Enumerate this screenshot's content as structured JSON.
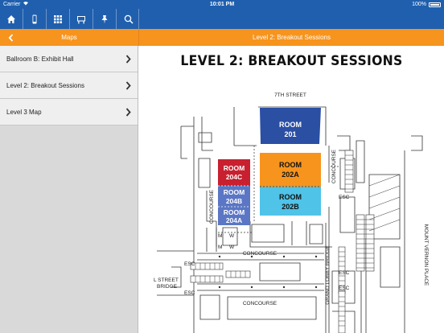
{
  "status": {
    "carrier": "Carrier",
    "time": "10:01 PM",
    "battery": "100%"
  },
  "toolbar": {
    "icons": [
      "home-icon",
      "phone-icon",
      "grid-icon",
      "exhibit-icon",
      "pin-icon",
      "search-icon"
    ]
  },
  "navbar": {
    "left_title": "Maps",
    "right_title": "Level 2: Breakout Sessions"
  },
  "sidebar": {
    "items": [
      {
        "label": "Ballroom B: Exhibit Hall"
      },
      {
        "label": "Level 2: Breakout Sessions"
      },
      {
        "label": "Level 3 Map"
      }
    ]
  },
  "map": {
    "title": "LEVEL 2: BREAKOUT SESSIONS",
    "labels": {
      "street_top": "7TH STREET",
      "concourse_left": "CONCOURSE",
      "concourse_right": "CONCOURSE",
      "concourse_mid": "CONCOURSE",
      "concourse_bottom": "CONCOURSE",
      "mount_vernon": "MOUNT VERNON PLACE",
      "grand_lobby": "GRAND LOBBY BRIDGE",
      "l_street": "L STREET",
      "bridge": "BRIDGE",
      "esc1": "ESC",
      "esc2": "ESC",
      "esc3": "ESC",
      "esc4": "ESC",
      "esc5": "ESC",
      "m1": "M",
      "w1": "W",
      "m2": "M",
      "w2": "W"
    },
    "rooms": [
      {
        "line1": "ROOM",
        "line2": "201",
        "color": "#2a4fa3"
      },
      {
        "line1": "ROOM",
        "line2": "202A",
        "color": "#f7941d"
      },
      {
        "line1": "ROOM",
        "line2": "202B",
        "color": "#4fc3e8"
      },
      {
        "line1": "ROOM",
        "line2": "204C",
        "color": "#c8202f"
      },
      {
        "line1": "ROOM",
        "line2": "204B",
        "color": "#5b76c4"
      },
      {
        "line1": "ROOM",
        "line2": "204A",
        "color": "#5b76c4"
      }
    ]
  }
}
